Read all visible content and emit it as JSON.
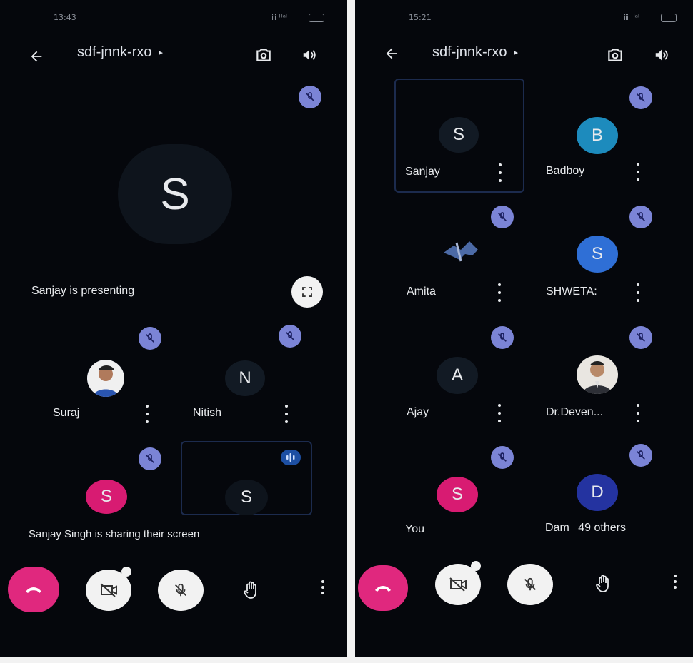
{
  "left": {
    "status_time": "13:43",
    "status_right": "ⅲ ᴴᵃˡ",
    "meeting_code": "sdf-jnnk-rxo",
    "caret": "▸",
    "presenter_initial": "S",
    "presenting_text": "Sanjay is presenting",
    "participants": [
      {
        "name": "Suraj",
        "initial": ""
      },
      {
        "name": "Nitish",
        "initial": "N"
      },
      {
        "name": "",
        "initial": "S"
      },
      {
        "name": "",
        "initial": "S"
      }
    ],
    "sharing_text": "Sanjay Singh is sharing their screen"
  },
  "right": {
    "status_time": "15:21",
    "status_right": "ⅲ ᴴᵃˡ",
    "meeting_code": "sdf-jnnk-rxo",
    "caret": "▸",
    "participants": [
      {
        "name": "Sanjay",
        "initial": "S",
        "color": "#121a24"
      },
      {
        "name": "Badboy",
        "initial": "B",
        "color": "#1d8bbd"
      },
      {
        "name": "Amita",
        "initial": "",
        "color": ""
      },
      {
        "name": "SHWETA:",
        "initial": "S",
        "color": "#2f6fd6"
      },
      {
        "name": "Ajay",
        "initial": "A",
        "color": "#121a24"
      },
      {
        "name": "Dr.Deven...",
        "initial": "",
        "color": ""
      },
      {
        "name": "You",
        "initial": "S",
        "color": "#d81b72"
      },
      {
        "name": "Dam",
        "initial": "D",
        "color": "#2433a0"
      }
    ],
    "others_text": "49 others"
  },
  "colors": {
    "hangup": "#e0287e",
    "mic_badge": "#7b84d6",
    "background": "#05070c"
  },
  "icons": [
    "back-arrow-icon",
    "camera-switch-icon",
    "speaker-icon",
    "mic-off-icon",
    "fullscreen-icon",
    "more-vert-icon",
    "hangup-icon",
    "video-off-icon",
    "raise-hand-icon",
    "audio-level-icon"
  ]
}
